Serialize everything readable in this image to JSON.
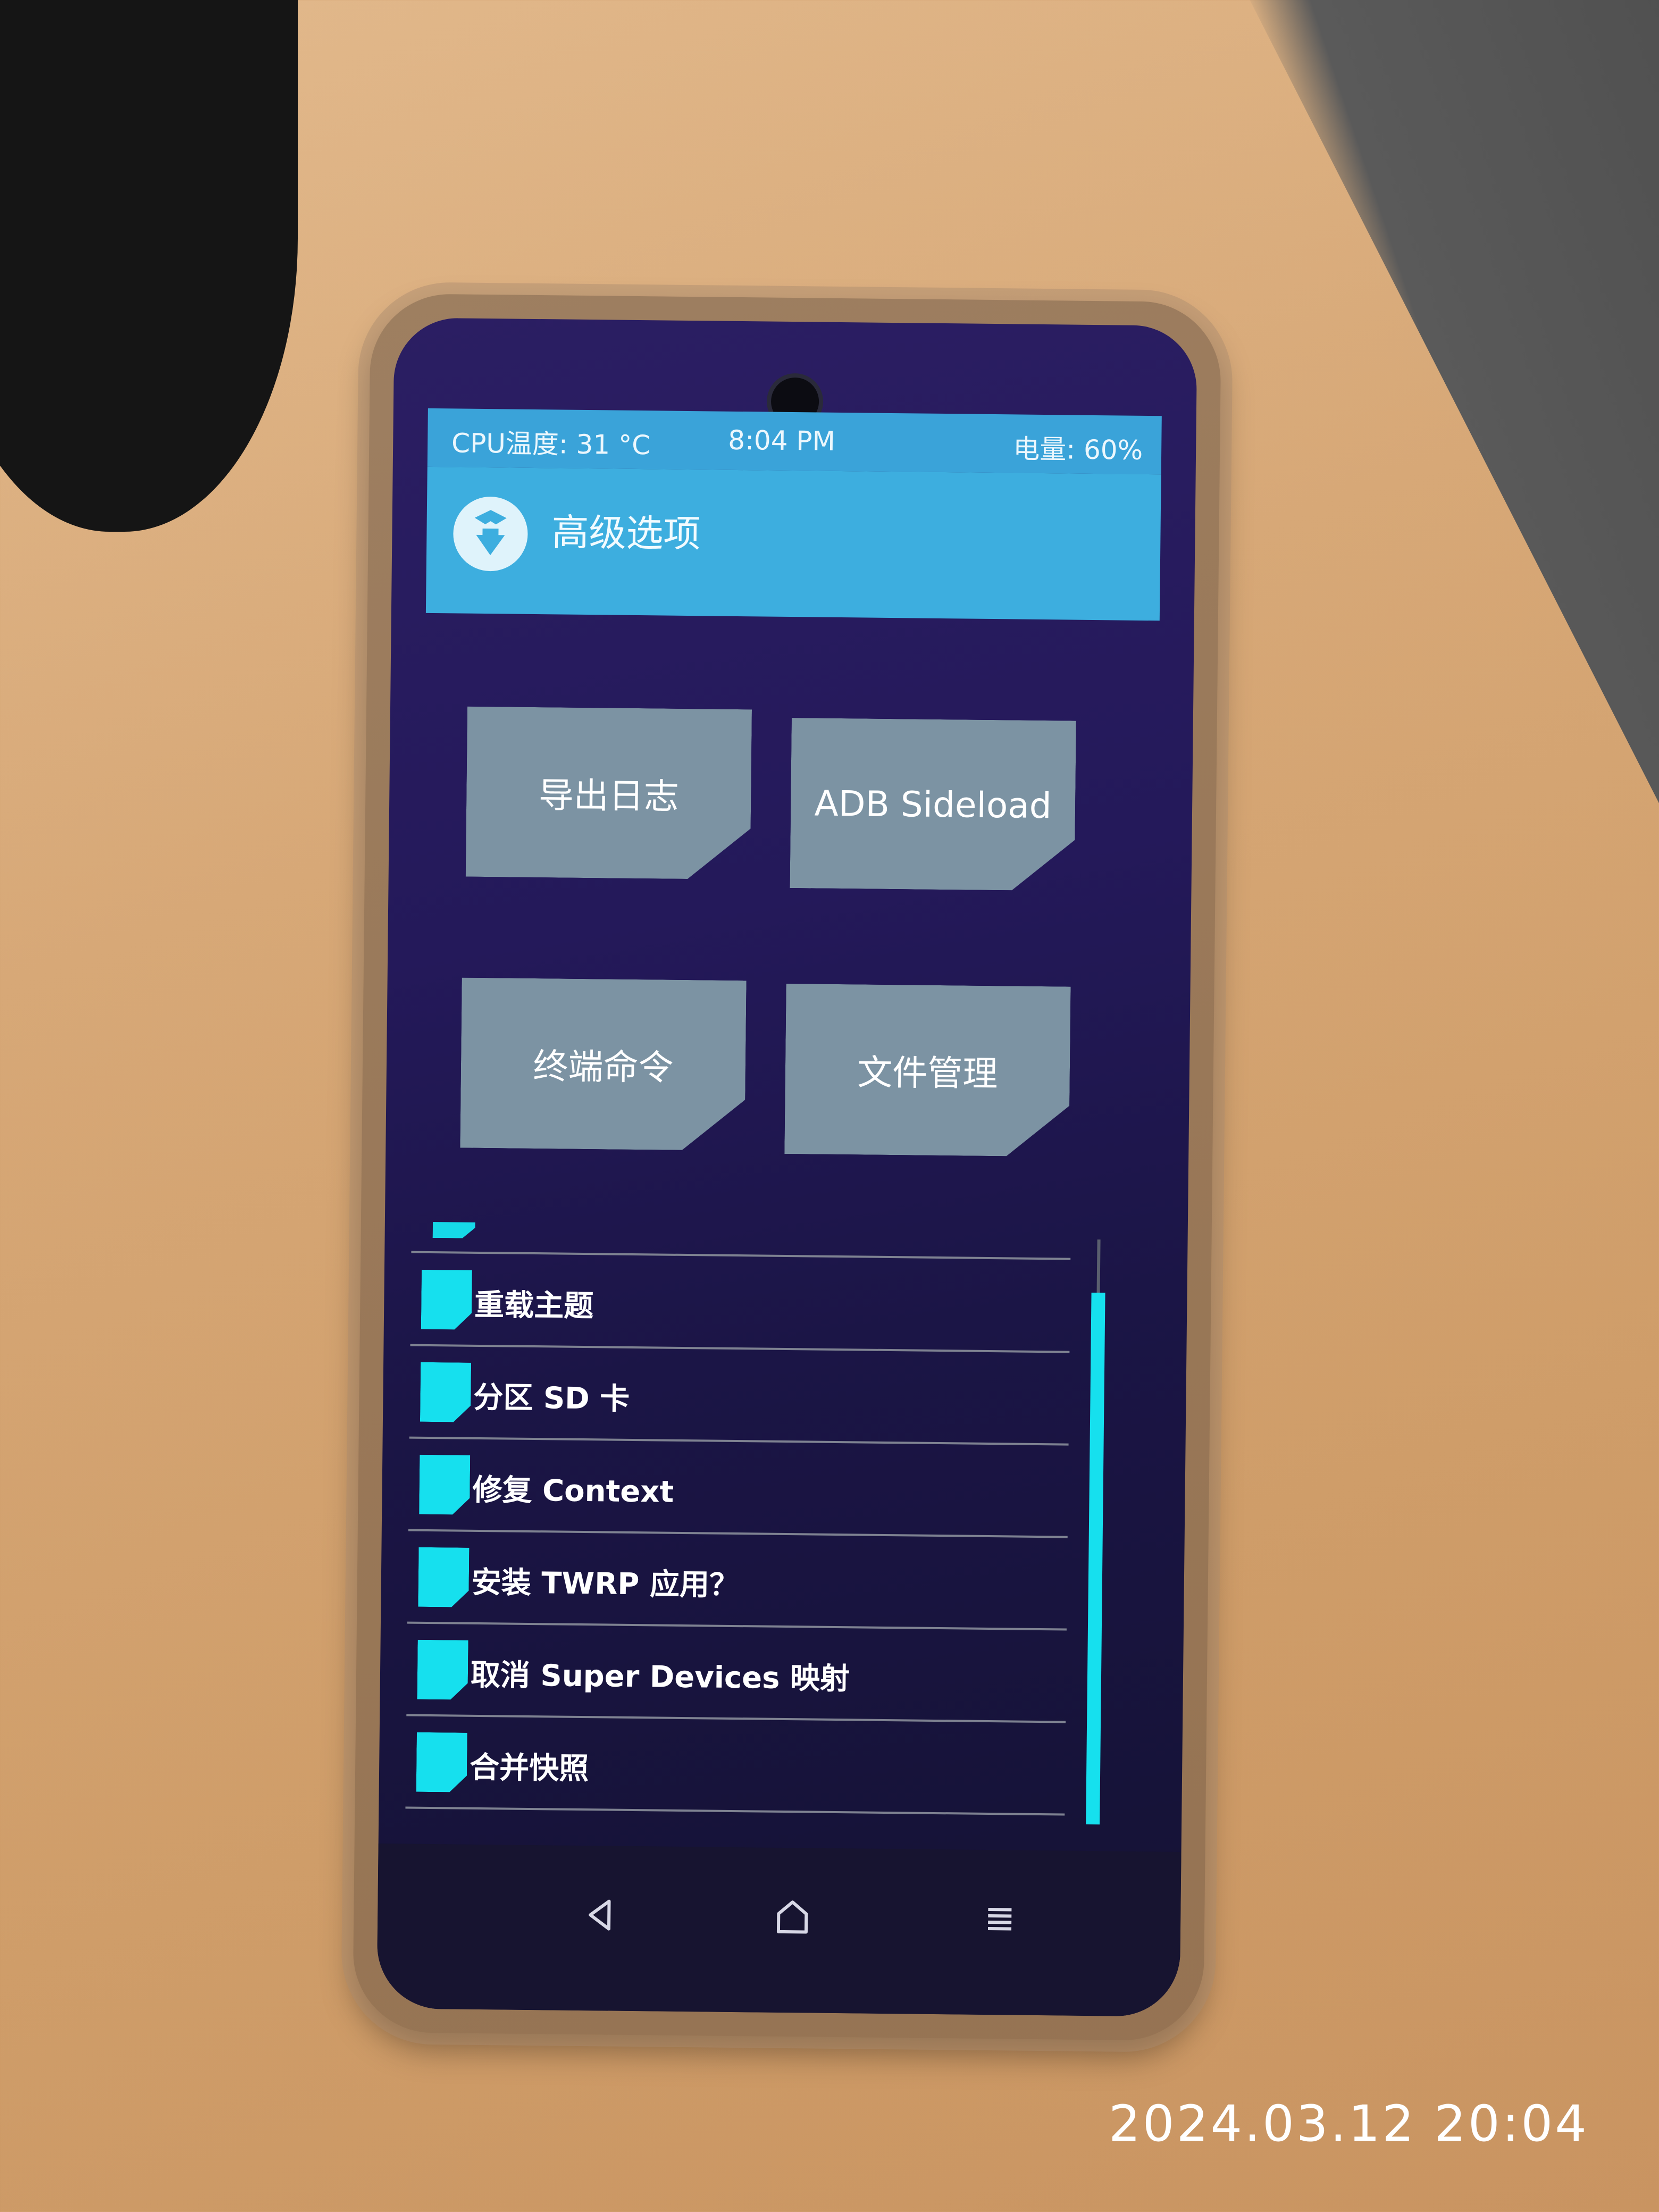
{
  "status_bar": {
    "cpu_temp": "CPU温度: 31 °C",
    "time": "8:04 PM",
    "battery": "电量: 60%"
  },
  "header": {
    "title": "高级选项",
    "logo_icon": "twrp-logo-icon"
  },
  "tiles": [
    {
      "label": "导出日志"
    },
    {
      "label": "ADB Sideload"
    },
    {
      "label": "终端命令"
    },
    {
      "label": "文件管理"
    }
  ],
  "list": {
    "items": [
      {
        "label": "重载主题"
      },
      {
        "label": "分区 SD 卡"
      },
      {
        "label": "修复 Context"
      },
      {
        "label": "安装 TWRP 应用？"
      },
      {
        "label": "取消 Super Devices 映射"
      },
      {
        "label": "合并快照"
      }
    ]
  },
  "nav_bar": {
    "back_icon": "back-triangle-icon",
    "home_icon": "home-icon",
    "menu_icon": "menu-lines-icon"
  },
  "photo_stamp": "2024.03.12  20:04",
  "colors": {
    "header_blue": "#3daedf",
    "accent_cyan": "#16e0ee",
    "tile_gray": "#7c93a3"
  }
}
